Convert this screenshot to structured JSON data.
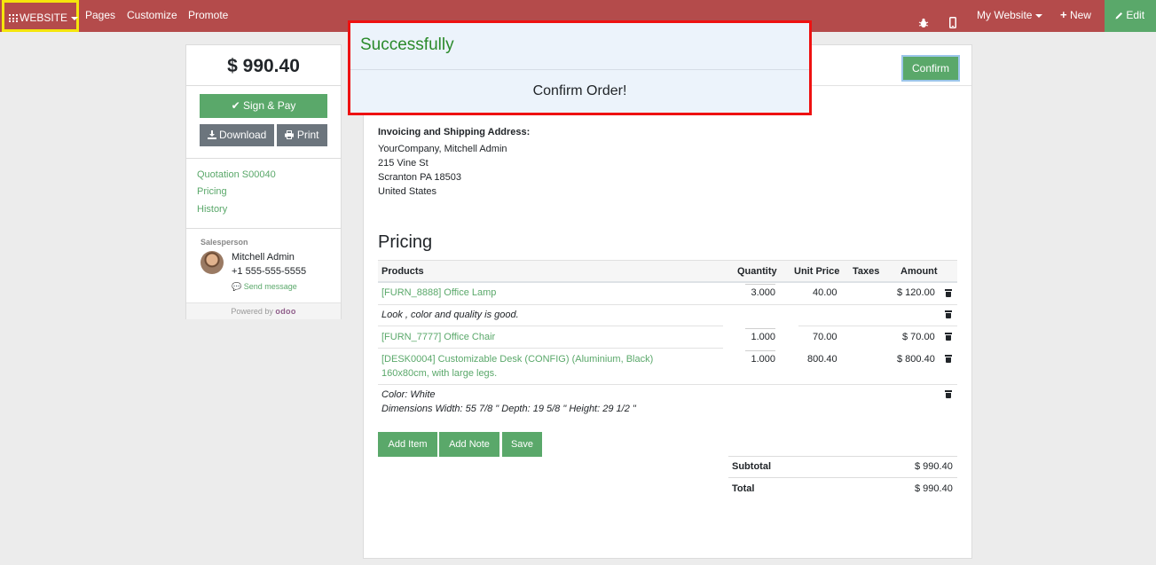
{
  "navbar": {
    "website_label": "WEBSITE",
    "pages_label": "Pages",
    "customize_label": "Customize",
    "promote_label": "Promote",
    "my_website_label": "My Website",
    "new_label": "New",
    "edit_label": "Edit",
    "bar_color": "#b44b4b",
    "edit_color": "#5aa86a"
  },
  "sidebar": {
    "amount": "$ 990.40",
    "sign_pay_label": "Sign & Pay",
    "download_label": "Download",
    "print_label": "Print",
    "links": [
      "Quotation S00040",
      "Pricing",
      "History"
    ],
    "salesperson_label": "Salesperson",
    "salesperson_name": "Mitchell Admin",
    "salesperson_phone": "+1 555-555-5555",
    "send_message_label": "Send message",
    "powered_label": "Powered by",
    "powered_brand": "odoo"
  },
  "modal": {
    "title": "Successfully",
    "body": "Confirm Order!"
  },
  "document": {
    "confirm_label": "Confirm",
    "address_title": "Invoicing and Shipping Address:",
    "address_lines": [
      "YourCompany, Mitchell Admin",
      "215 Vine St",
      "Scranton PA 18503",
      "United States"
    ],
    "pricing_title": "Pricing",
    "columns": {
      "products": "Products",
      "quantity": "Quantity",
      "unit_price": "Unit Price",
      "taxes": "Taxes",
      "amount": "Amount"
    },
    "lines": [
      {
        "product": "[FURN_8888] Office Lamp",
        "quantity": "3.000",
        "unit_price": "40.00",
        "amount": "$ 120.00"
      },
      {
        "note": "Look , color and quality is good."
      },
      {
        "product": "[FURN_7777] Office Chair",
        "quantity": "1.000",
        "unit_price": "70.00",
        "amount": "$ 70.00"
      },
      {
        "product_line1": "[DESK0004] Customizable Desk (CONFIG) (Aluminium, Black)",
        "product_line2": "160x80cm, with large legs.",
        "quantity": "1.000",
        "unit_price": "800.40",
        "amount": "$ 800.40"
      },
      {
        "note_line1": "Color: White",
        "note_line2": "Dimensions Width: 55 7/8 \" Depth: 19 5/8 \" Height: 29 1/2 \""
      }
    ],
    "add_item_label": "Add Item",
    "add_note_label": "Add Note",
    "save_label": "Save",
    "subtotal_label": "Subtotal",
    "subtotal_value": "$ 990.40",
    "total_label": "Total",
    "total_value": "$ 990.40"
  }
}
